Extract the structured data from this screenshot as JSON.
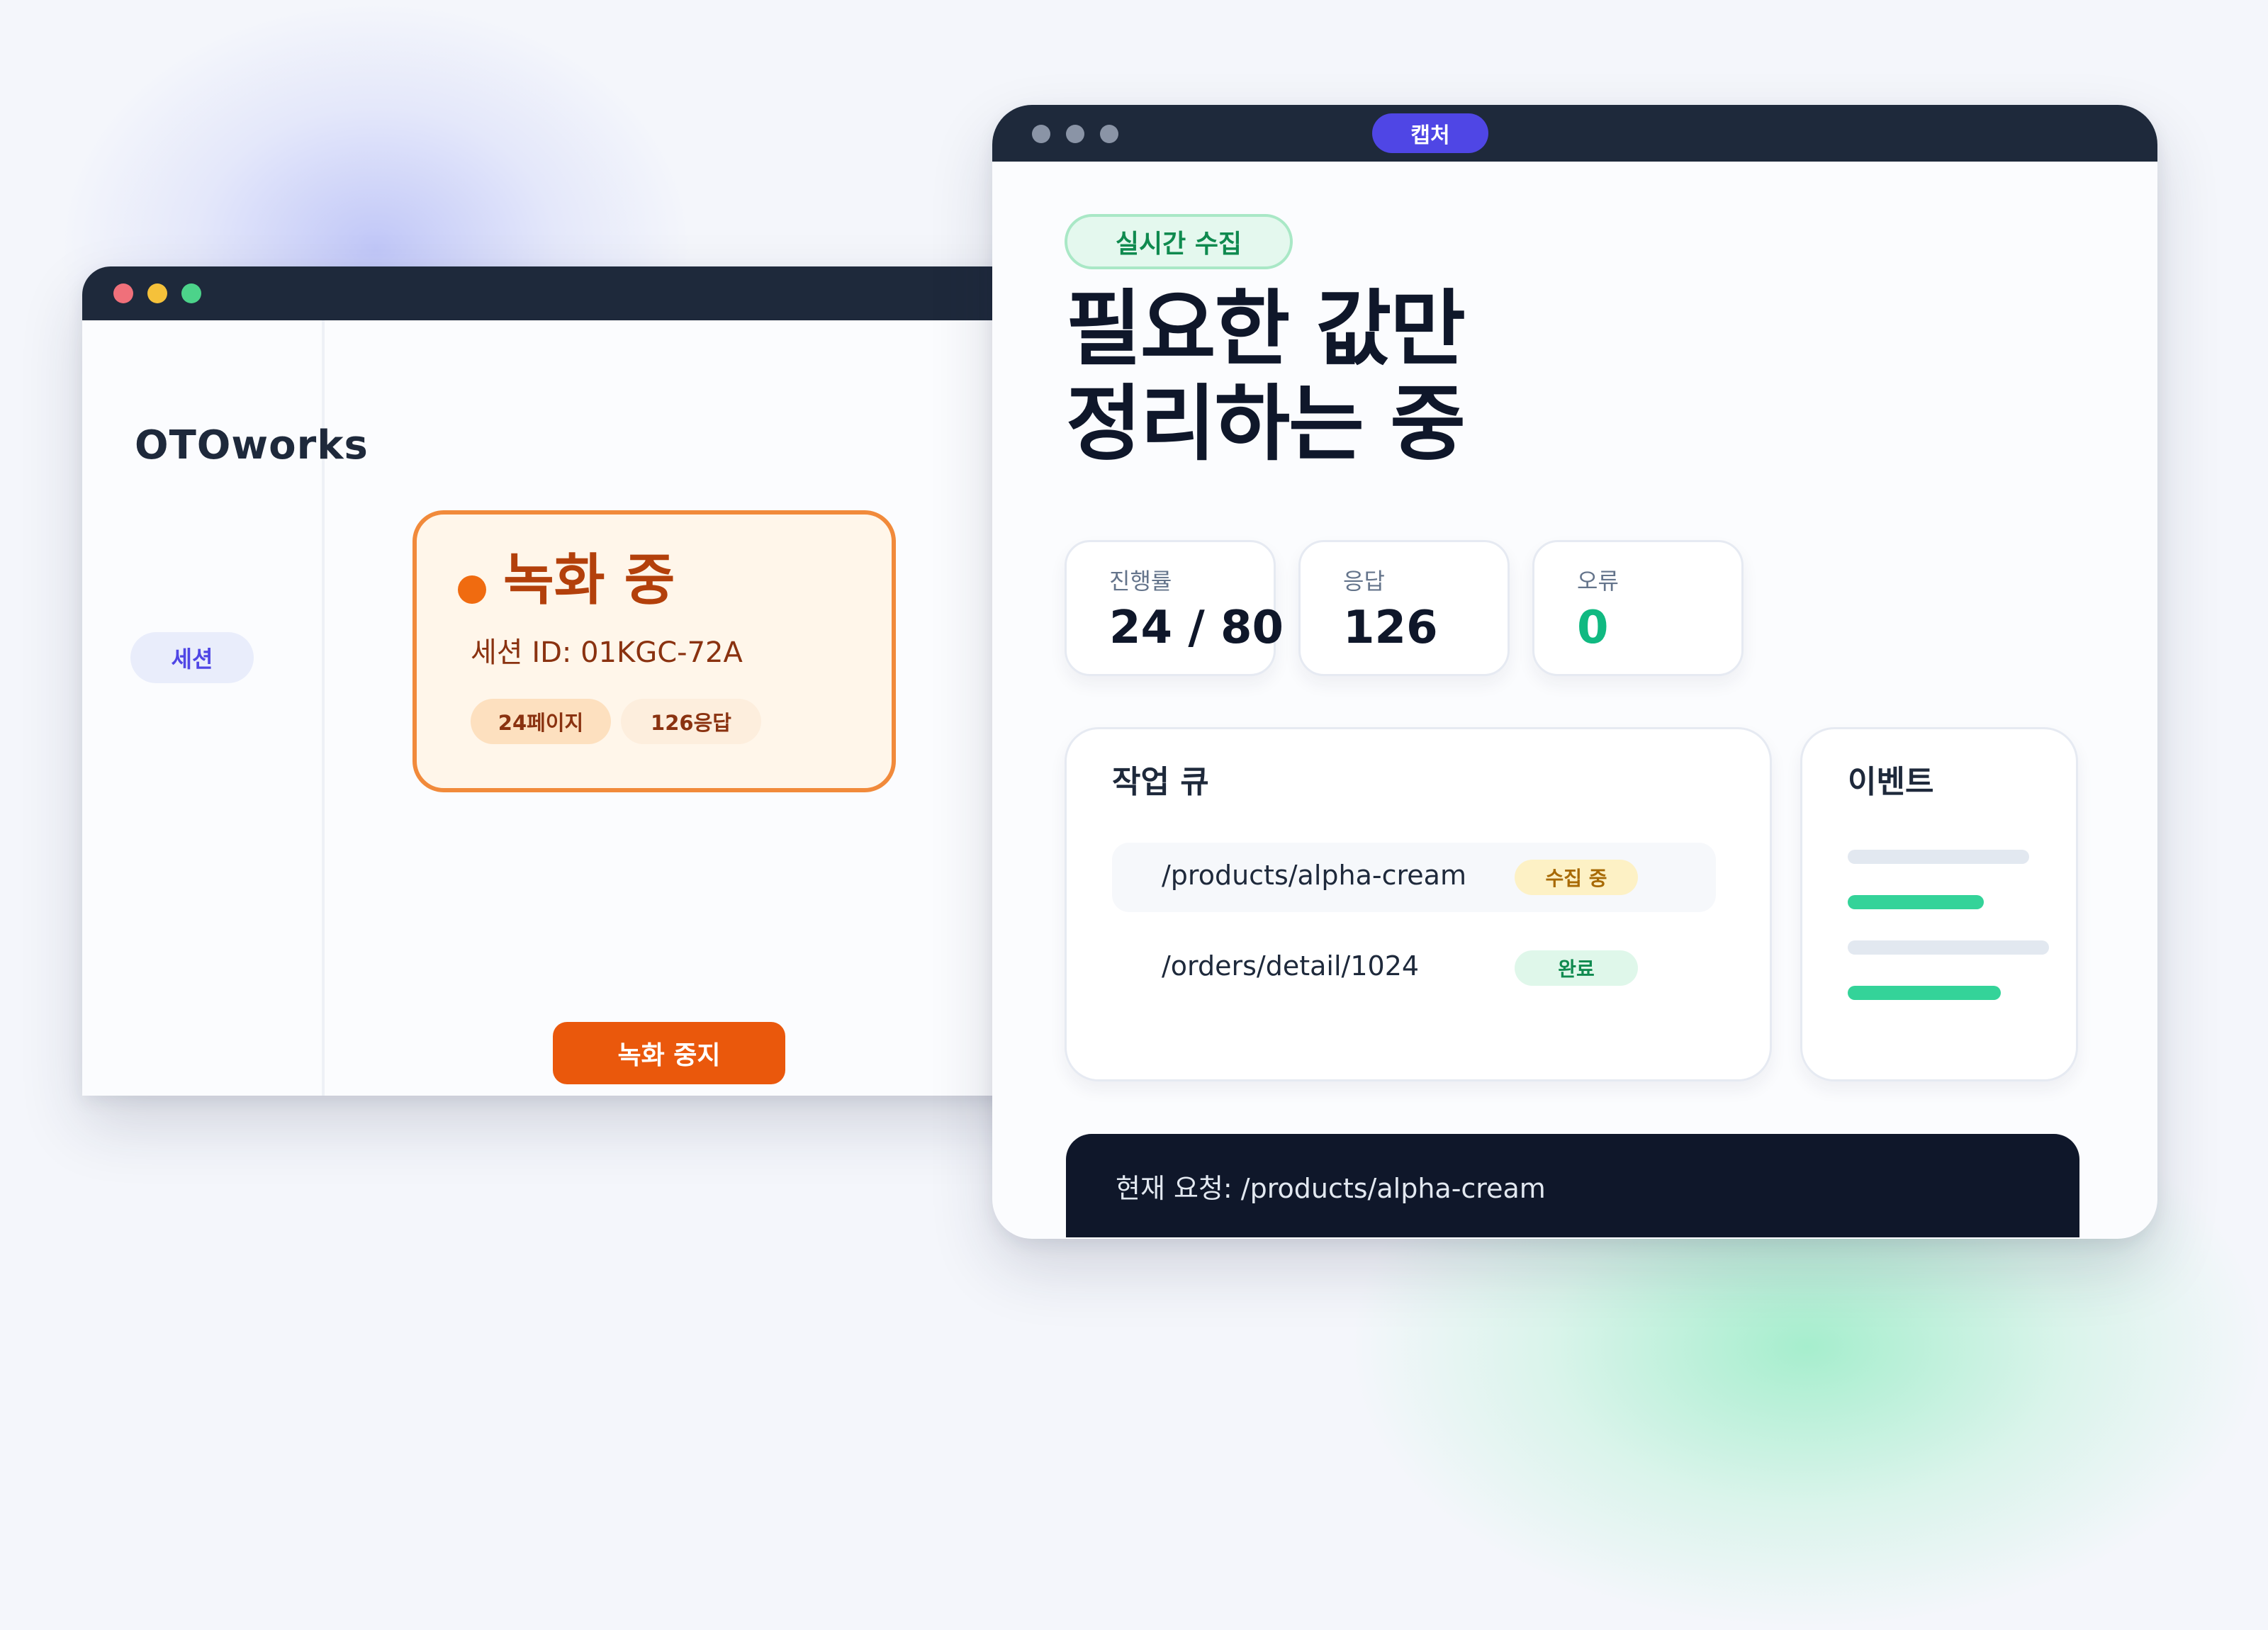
{
  "back_window": {
    "brand": "OTOworks",
    "nav": {
      "session_label": "세션"
    },
    "recording": {
      "title": "녹화 중",
      "session_id": "세션 ID: 01KGC-72A",
      "chips": [
        "24페이지",
        "126응답"
      ],
      "stop_label": "녹화 중지"
    }
  },
  "front_window": {
    "capture_label": "캡처",
    "live_badge": "실시간 수집",
    "headline": [
      "필요한 값만",
      "정리하는 중"
    ],
    "stats": [
      {
        "label": "진행률",
        "value": "24 / 80"
      },
      {
        "label": "응답",
        "value": "126"
      },
      {
        "label": "오류",
        "value": "0"
      }
    ],
    "queue": {
      "title": "작업 큐",
      "rows": [
        {
          "path": "/products/alpha-cream",
          "status": "수집 중"
        },
        {
          "path": "/orders/detail/1024",
          "status": "완료"
        }
      ]
    },
    "events": {
      "title": "이벤트"
    },
    "current_request": "현재 요청: /products/alpha-cream"
  },
  "colors": {
    "titlebar": "#1e293b",
    "accent": "#4f46e5",
    "recording": "#ea580c",
    "success": "#10b981",
    "in_progress": "#a86a05"
  }
}
